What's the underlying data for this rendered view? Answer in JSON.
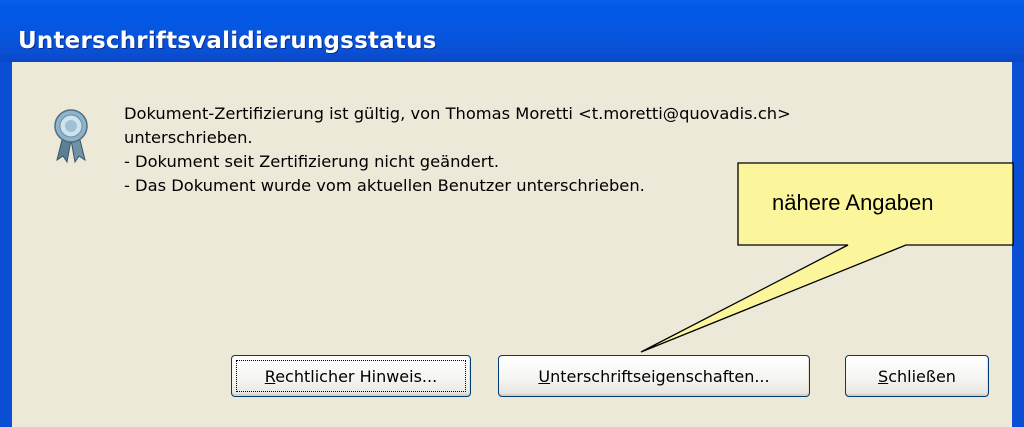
{
  "window": {
    "title": "Unterschriftsvalidierungsstatus"
  },
  "icon": {
    "name": "certification-ribbon-icon"
  },
  "message": {
    "line1": "Dokument-Zertifizierung ist gültig, von Thomas Moretti <t.moretti@quovadis.ch>",
    "line2": "unterschrieben.",
    "line3": "- Dokument seit Zertifizierung nicht geändert.",
    "line4": "- Das Dokument wurde vom aktuellen Benutzer unterschrieben."
  },
  "buttons": {
    "legal": {
      "accesskey": "R",
      "rest": "echtlicher Hinweis..."
    },
    "properties": {
      "accesskey": "U",
      "rest": "nterschriftseigenschaften..."
    },
    "close": {
      "accesskey": "S",
      "rest": "chließen"
    }
  },
  "callout": {
    "text": "nähere Angaben"
  },
  "colors": {
    "titlebar": "#0058e6",
    "dialog_bg": "#ece9d8",
    "callout_fill": "#fbf59b",
    "button_border": "#003c74"
  }
}
